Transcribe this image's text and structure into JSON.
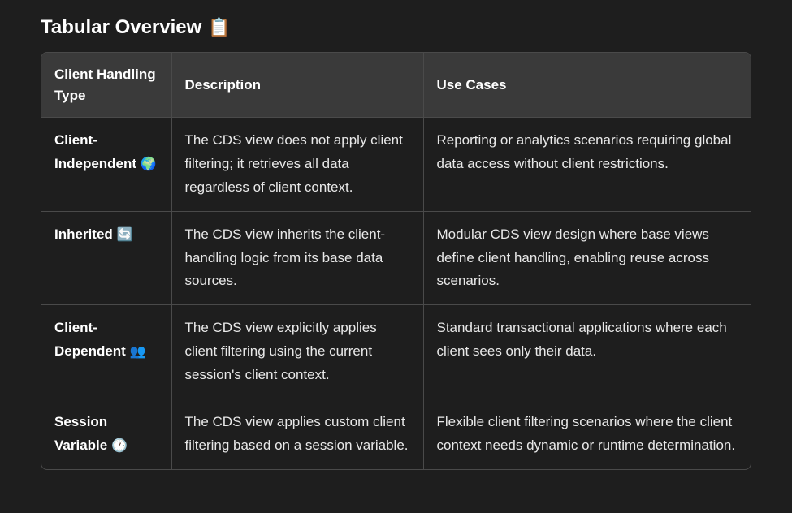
{
  "heading": {
    "title": "Tabular Overview",
    "icon": "📋"
  },
  "table": {
    "headers": {
      "type": "Client Handling Type",
      "description": "Description",
      "usecases": "Use Cases"
    },
    "rows": [
      {
        "type": "Client-Independent",
        "icon": "🌍",
        "description": "The CDS view does not apply client filtering; it retrieves all data regardless of client context.",
        "usecases": "Reporting or analytics scenarios requiring global data access without client restrictions."
      },
      {
        "type": "Inherited",
        "icon": "🔄",
        "description": "The CDS view inherits the client-handling logic from its base data sources.",
        "usecases": "Modular CDS view design where base views define client handling, enabling reuse across scenarios."
      },
      {
        "type": "Client-Dependent",
        "icon": "👥",
        "description": "The CDS view explicitly applies client filtering using the current session's client context.",
        "usecases": "Standard transactional applications where each client sees only their data."
      },
      {
        "type": "Session Variable",
        "icon": "🕐",
        "description": "The CDS view applies custom client filtering based on a session variable.",
        "usecases": "Flexible client filtering scenarios where the client context needs dynamic or runtime determination."
      }
    ]
  }
}
